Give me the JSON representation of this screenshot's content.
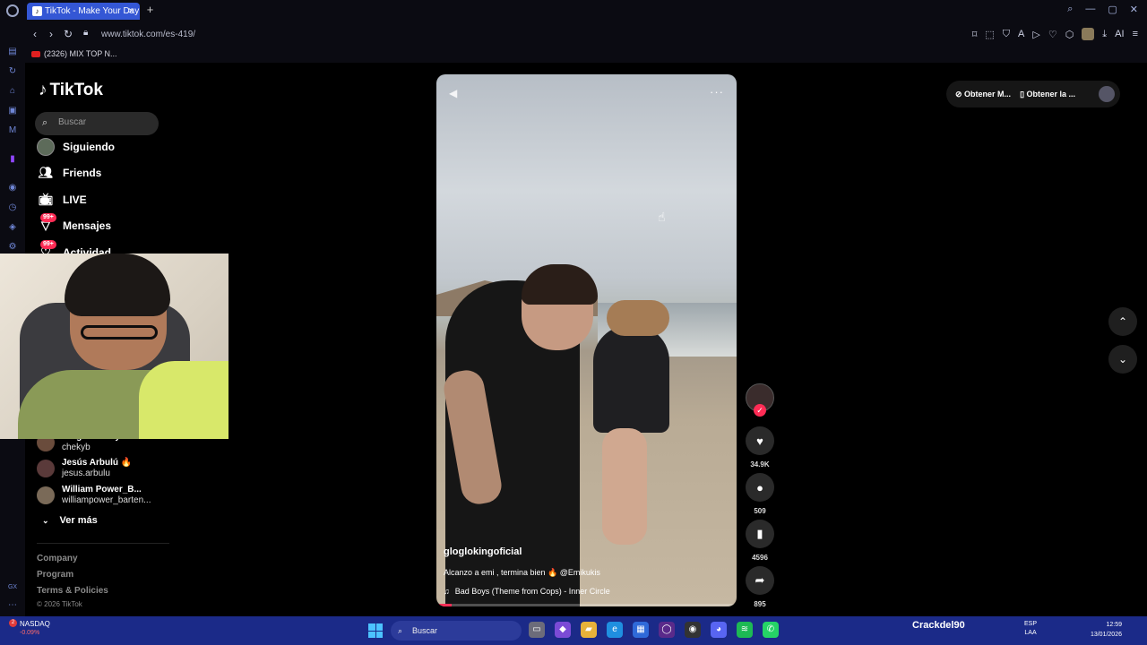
{
  "browser": {
    "tab_title": "TikTok - Make Your Day",
    "url": "www.tiktok.com/es-419/",
    "bookmark": "(2326) MIX TOP N..."
  },
  "sidebar": {
    "logo": "TikTok",
    "search_placeholder": "Buscar",
    "nav": [
      {
        "label": "Siguiendo",
        "icon": "avatar"
      },
      {
        "label": "Friends",
        "icon": "friends-icon"
      },
      {
        "label": "LIVE",
        "icon": "live-icon"
      },
      {
        "label": "Mensajes",
        "icon": "messages-icon",
        "badge": "99+"
      },
      {
        "label": "Actividad",
        "icon": "activity-icon",
        "badge": "99+"
      }
    ],
    "following": [
      {
        "name": "Sergio Chony Dalz",
        "user": "chekyb"
      },
      {
        "name": "Jesús Arbulú 🔥",
        "user": "jesus.arbulu"
      },
      {
        "name": "William Power_B...",
        "user": "williampower_barten..."
      }
    ],
    "see_more": "Ver más",
    "footer": [
      "Company",
      "Program",
      "Terms & Policies"
    ],
    "copyright": "© 2026 TikTok"
  },
  "video": {
    "author": "gloglokingoficial",
    "caption": "Alcanzo a emi , termina bien 🔥 @Emikukis",
    "music": "Bad Boys (Theme from Cops) - Inner Circle",
    "progress": 0.05
  },
  "actions": {
    "likes": "34.9K",
    "comments": "509",
    "saves": "4596",
    "shares": "895"
  },
  "top_right": {
    "coins": "Obtener M...",
    "app": "Obtener la ..."
  },
  "taskbar": {
    "ticker": "NASDAQ",
    "ticker_change": "-0.09%",
    "ticker_badge": "2",
    "search": "Buscar",
    "streamer": "Crackdel90",
    "lang": "ESP",
    "lang2": "LAA",
    "time": "12:59",
    "date": "13/01/2026"
  },
  "colors": {
    "accent": "#fe2c55",
    "tab": "#3457d5",
    "taskbar": "#1b2a88"
  }
}
